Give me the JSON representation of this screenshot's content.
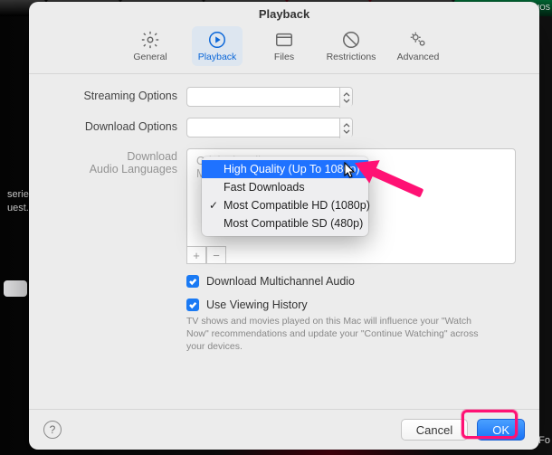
{
  "window": {
    "title": "Playback"
  },
  "tabs": {
    "general": "General",
    "playback": "Playback",
    "files": "Files",
    "restrictions": "Restrictions",
    "advanced": "Advanced"
  },
  "labels": {
    "streaming": "Streaming Options",
    "download": "Download Options",
    "audiolang_l1": "Download",
    "audiolang_l2": "Audio Languages"
  },
  "dropdown": {
    "opt0": "High Quality (Up To 1080p)",
    "opt1": "Fast Downloads",
    "opt2": "Most Compatible HD (1080p)",
    "opt3": "Most Compatible SD (480p)"
  },
  "langbox": {
    "line1": "Original Audio Language",
    "line2": "Mac Language: English",
    "plus": "+",
    "minus": "−"
  },
  "checks": {
    "multichannel": "Download Multichannel Audio",
    "history": "Use Viewing History",
    "history_desc": "TV shows and movies played on this Mac will influence your \"Watch Now\" recommendations and update your \"Continue Watching\" across your devices."
  },
  "footer": {
    "help": "?",
    "cancel": "Cancel",
    "ok": "OK"
  },
  "bg": {
    "side": "series uest.",
    "r1": "MOS",
    "r2": "Fo"
  }
}
